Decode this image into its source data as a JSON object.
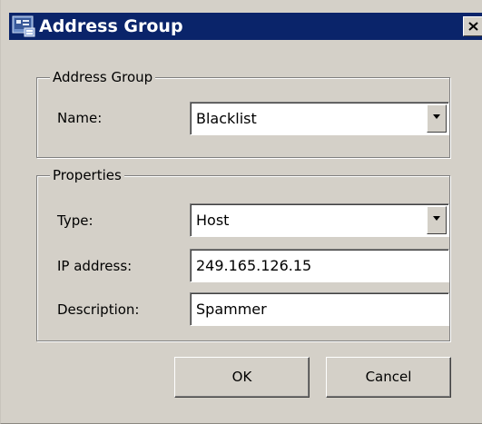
{
  "window": {
    "title": "Address Group",
    "icon": "app-icon",
    "close_icon": "close-icon"
  },
  "address_group": {
    "legend": "Address Group",
    "name_label": "Name:",
    "name_value": "Blacklist"
  },
  "properties": {
    "legend": "Properties",
    "type_label": "Type:",
    "type_value": "Host",
    "ip_label": "IP address:",
    "ip_value": "249.165.126.15",
    "description_label": "Description:",
    "description_value": "Spammer"
  },
  "buttons": {
    "ok": "OK",
    "cancel": "Cancel"
  },
  "colors": {
    "titlebar": "#0a246a",
    "dialog_bg": "#d4d0c8"
  }
}
